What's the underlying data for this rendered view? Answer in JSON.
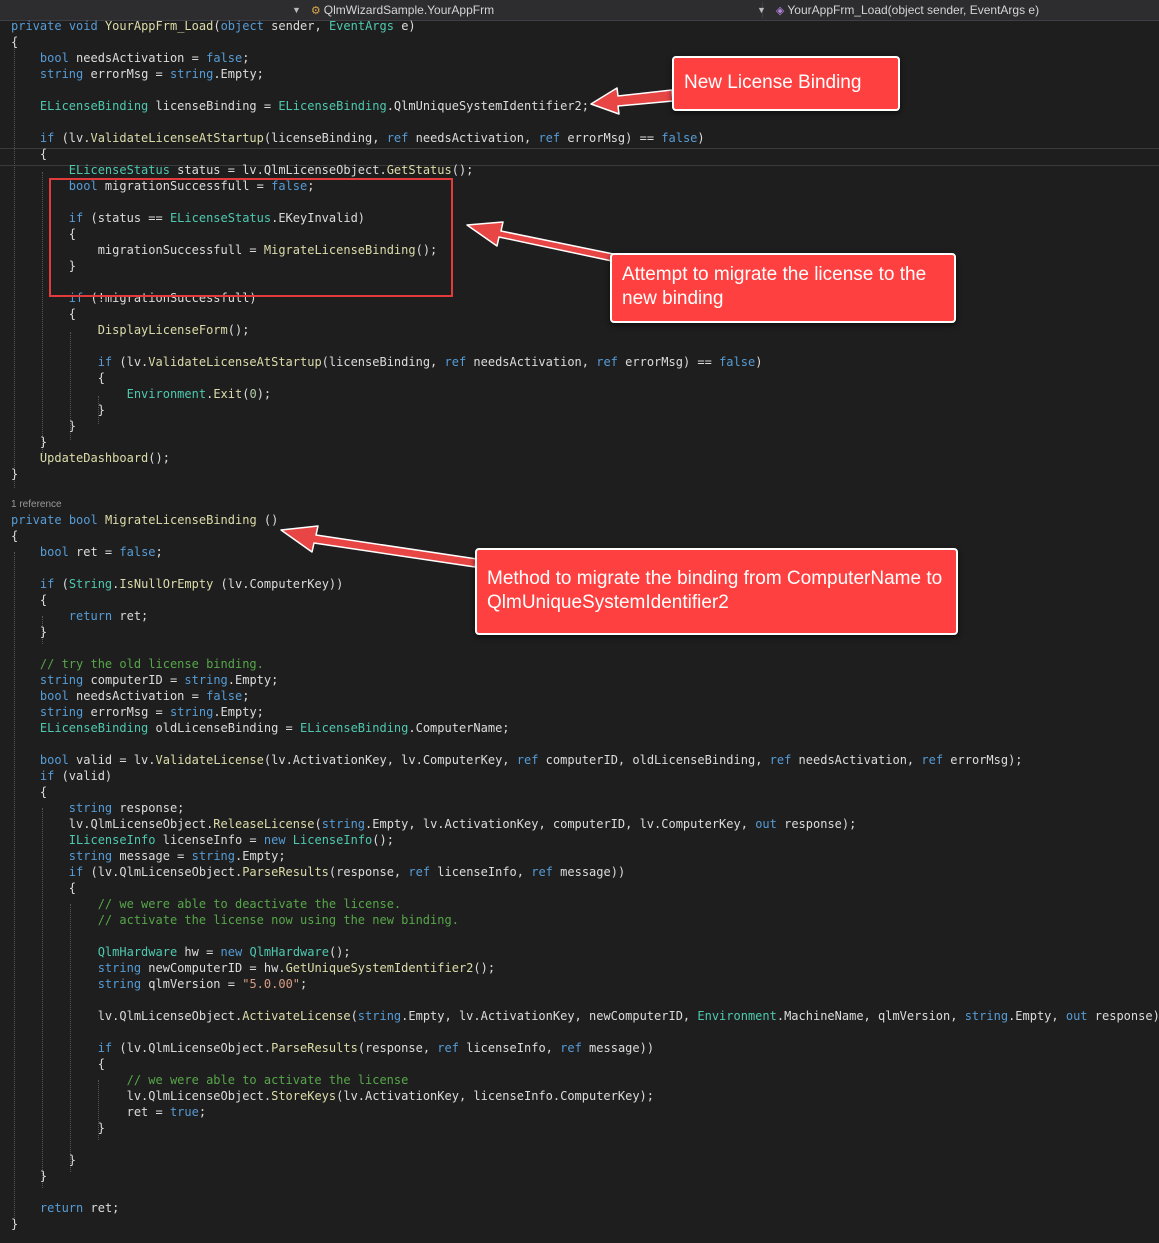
{
  "navbar": {
    "class_path": "QlmWizardSample.YourAppFrm",
    "member": "YourAppFrm_Load(object sender, EventArgs e)"
  },
  "code": {
    "l01": "private void YourAppFrm_Load(object sender, EventArgs e)",
    "l02": "{",
    "l03": "    bool needsActivation = false;",
    "l04": "    string errorMsg = string.Empty;",
    "l05": "    ELicenseBinding licenseBinding = ELicenseBinding.QlmUniqueSystemIdentifier2;",
    "l06": "    if (lv.ValidateLicenseAtStartup(licenseBinding, ref needsActivation, ref errorMsg) == false)",
    "l07": "    {",
    "l08": "        ELicenseStatus status = lv.QlmLicenseObject.GetStatus();",
    "l09": "        bool migrationSuccessfull = false;",
    "l10": "        if (status == ELicenseStatus.EKeyInvalid)",
    "l11": "        {",
    "l12": "            migrationSuccessfull = MigrateLicenseBinding();",
    "l13": "        }",
    "l14": "        if (!migrationSuccessfull)",
    "l15": "        {",
    "l16": "            DisplayLicenseForm();",
    "l17": "            if (lv.ValidateLicenseAtStartup(licenseBinding, ref needsActivation, ref errorMsg) == false)",
    "l18": "            {",
    "l19": "                Environment.Exit(0);",
    "l20": "            }",
    "l21": "        }",
    "l22": "    }",
    "l23": "    UpdateDashboard();",
    "l24": "}",
    "refs": "1 reference",
    "l25": "private bool MigrateLicenseBinding ()",
    "l26": "{",
    "l27": "    bool ret = false;",
    "l28": "    if (String.IsNullOrEmpty (lv.ComputerKey))",
    "l29": "    {",
    "l30": "        return ret;",
    "l31": "    }",
    "l32": "    // try the old license binding.",
    "l33": "    string computerID = string.Empty;",
    "l34": "    bool needsActivation = false;",
    "l35": "    string errorMsg = string.Empty;",
    "l36": "    ELicenseBinding oldLicenseBinding = ELicenseBinding.ComputerName;",
    "l37": "    bool valid = lv.ValidateLicense(lv.ActivationKey, lv.ComputerKey, ref computerID, oldLicenseBinding, ref needsActivation, ref errorMsg);",
    "l38": "    if (valid)",
    "l39": "    {",
    "l40": "        string response;",
    "l41": "        lv.QlmLicenseObject.ReleaseLicense(string.Empty, lv.ActivationKey, computerID, lv.ComputerKey, out response);",
    "l42": "        ILicenseInfo licenseInfo = new LicenseInfo();",
    "l43": "        string message = string.Empty;",
    "l44": "        if (lv.QlmLicenseObject.ParseResults(response, ref licenseInfo, ref message))",
    "l45": "        {",
    "l46": "            // we were able to deactivate the license.",
    "l47": "            // activate the license now using the new binding.",
    "l48": "            QlmHardware hw = new QlmHardware();",
    "l49": "            string newComputerID = hw.GetUniqueSystemIdentifier2();",
    "l50": "            string qlmVersion = \"5.0.00\";",
    "l51": "            lv.QlmLicenseObject.ActivateLicense(string.Empty, lv.ActivationKey, newComputerID, Environment.MachineName, qlmVersion, string.Empty, out response);",
    "l52": "            if (lv.QlmLicenseObject.ParseResults(response, ref licenseInfo, ref message))",
    "l53": "            {",
    "l54": "                // we were able to activate the license",
    "l55": "                lv.QlmLicenseObject.StoreKeys(lv.ActivationKey, licenseInfo.ComputerKey);",
    "l56": "                ret = true;",
    "l57": "            }",
    "l58": "        }",
    "l59": "    }",
    "l60": "    return ret;",
    "l61": "}"
  },
  "callouts": {
    "new_binding": "New License Binding",
    "migrate_attempt": "Attempt to migrate the license to the new binding",
    "migrate_method": "Method to migrate the binding from ComputerName to QlmUniqueSystemIdentifier2"
  },
  "colors": {
    "editor_bg": "#1e1e1e",
    "keyword": "#569cd6",
    "type": "#4ec9b0",
    "method": "#dcdcaa",
    "variable": "#9cdcfe",
    "string": "#d69d85",
    "number": "#b5cea8",
    "comment": "#57a64a",
    "callout_red": "#ff4040"
  }
}
